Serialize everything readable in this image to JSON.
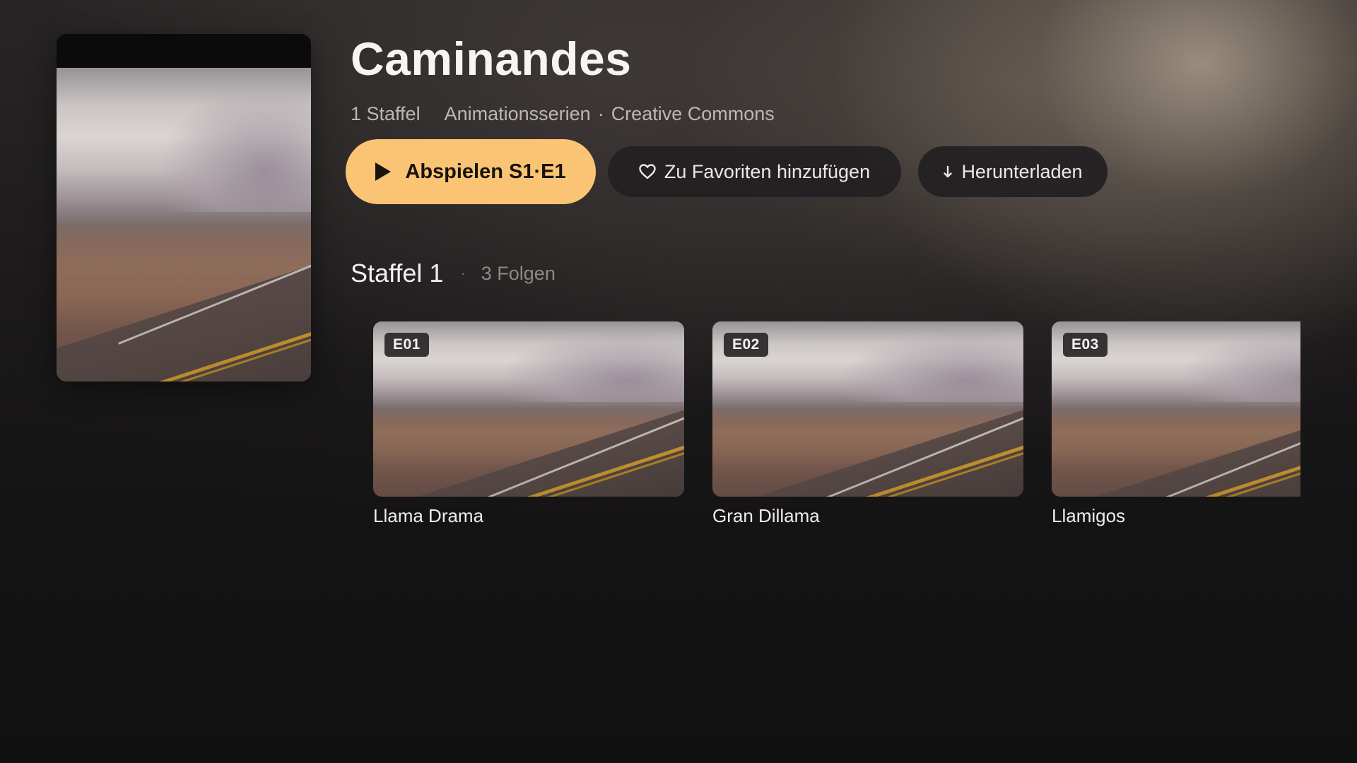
{
  "show": {
    "title": "Caminandes",
    "seasons_label": "1 Staffel",
    "genre": "Animationsserien",
    "separator": "·",
    "license": "Creative Commons"
  },
  "actions": {
    "play_label": "Abspielen S1·E1",
    "play_icon": "play-icon",
    "favorite_label": "Zu Favoriten hinzufügen",
    "favorite_icon": "heart-icon",
    "download_label": "Herunterladen",
    "download_icon": "download-arrow-icon",
    "accent_color": "#fbc474"
  },
  "season": {
    "name": "Staffel 1",
    "separator": "·",
    "count_label": "3 Folgen"
  },
  "episodes": [
    {
      "badge": "E01",
      "title": "Llama Drama"
    },
    {
      "badge": "E02",
      "title": "Gran Dillama"
    },
    {
      "badge": "E03",
      "title": "Llamigos"
    }
  ]
}
